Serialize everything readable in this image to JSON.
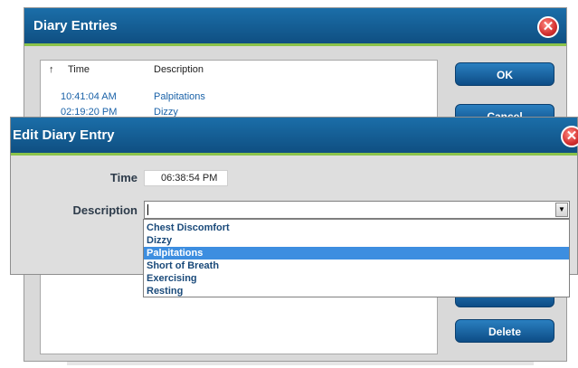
{
  "diary_window": {
    "title": "Diary Entries",
    "close_label": "✕",
    "list": {
      "sort_icon": "↑",
      "headers": {
        "time": "Time",
        "description": "Description"
      },
      "rows": [
        {
          "time": "10:41:04 AM",
          "description": "Palpitations"
        },
        {
          "time": "02:19:20 PM",
          "description": "Dizzy"
        }
      ]
    },
    "buttons": {
      "ok": "OK",
      "cancel": "Cancel",
      "delete": "Delete"
    }
  },
  "edit_window": {
    "title": "Edit Diary Entry",
    "close_label": "✕",
    "time_label": "Time",
    "time_value": "06:38:54 PM",
    "description_label": "Description",
    "description_value": "",
    "dropdown_arrow": "▼",
    "options": [
      {
        "label": "Chest Discomfort",
        "selected": false
      },
      {
        "label": "Dizzy",
        "selected": false
      },
      {
        "label": "Palpitations",
        "selected": true
      },
      {
        "label": "Short of Breath",
        "selected": false
      },
      {
        "label": "Exercising",
        "selected": false
      },
      {
        "label": "Resting",
        "selected": false
      }
    ]
  },
  "colors": {
    "titlebar": "#1565a1",
    "accent_green": "#8bc34a",
    "button": "#1a63a3",
    "selected_option": "#3d8ee0",
    "link_text": "#1a62a8"
  }
}
